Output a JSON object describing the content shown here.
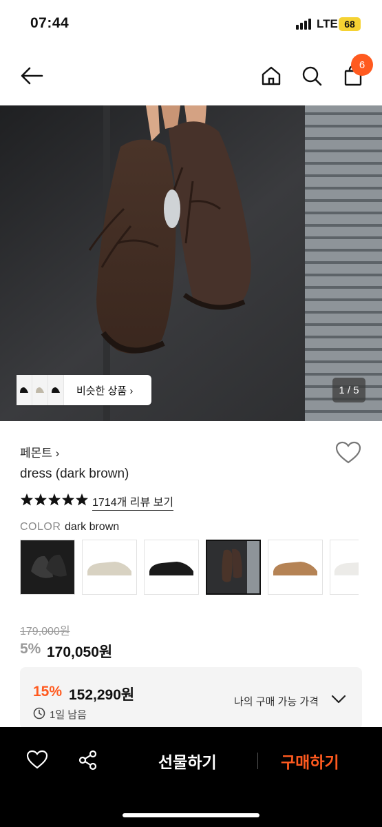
{
  "status_bar": {
    "time": "07:44",
    "network": "LTE",
    "battery": "68"
  },
  "nav": {
    "cart_count": "6",
    "icons": [
      "back-arrow-icon",
      "home-icon",
      "search-icon",
      "cart-icon"
    ]
  },
  "hero": {
    "similar_label": "비슷한 상품 ›",
    "page_indicator": "1 / 5"
  },
  "product": {
    "brand": "페몬트 ›",
    "title": "dress (dark brown)",
    "rating_stars": 5,
    "review_link": "1714개 리뷰 보기",
    "color_label": "COLOR",
    "color_value": "dark brown",
    "swatch_count": 6,
    "selected_swatch": 4
  },
  "pricing": {
    "original_price": "179,000원",
    "discount": "5%",
    "sale_price": "170,050원",
    "coupon_discount": "15%",
    "coupon_price": "152,290원",
    "coupon_remaining": "1일 남음",
    "my_price_label": "나의 구매 가능 가격"
  },
  "bottom_bar": {
    "gift_label": "선물하기",
    "buy_label": "구매하기"
  },
  "colors": {
    "accent": "#ff5a1f",
    "battery": "#f5d233"
  }
}
